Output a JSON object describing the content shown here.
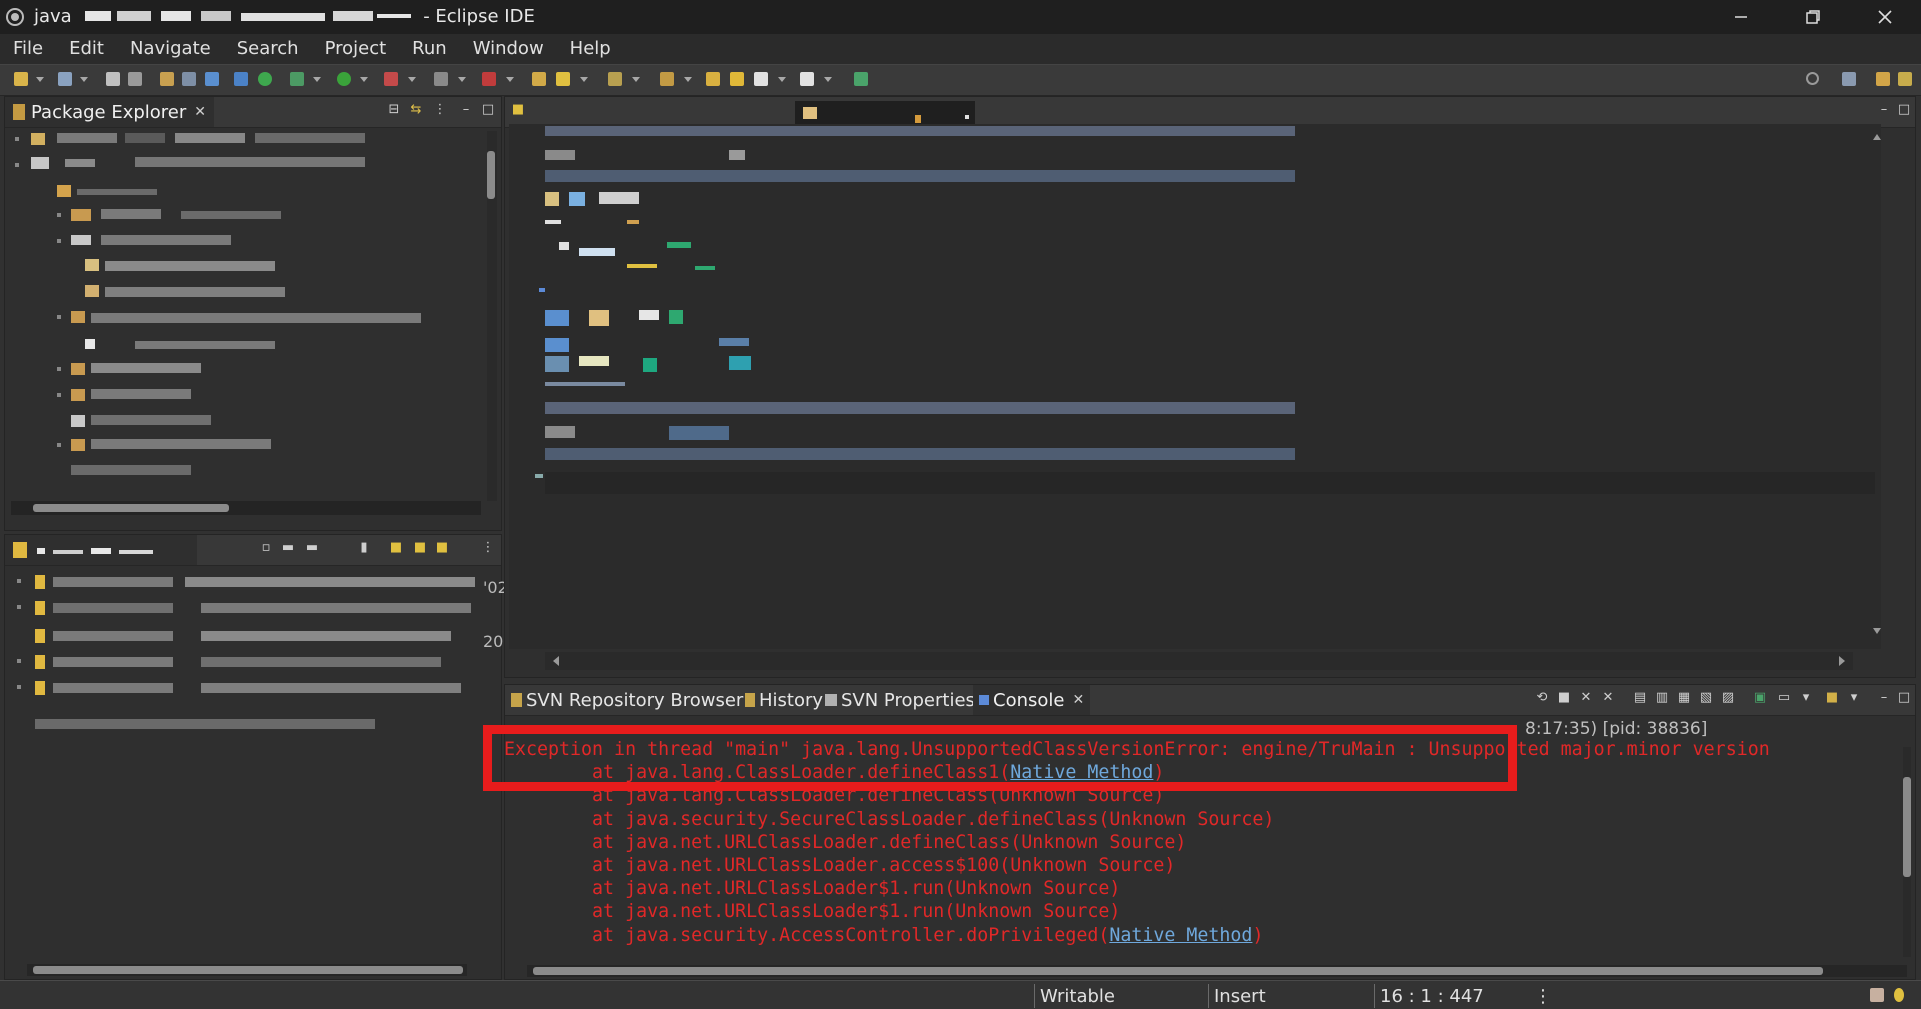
{
  "window": {
    "app_name": "java",
    "title_suffix": "- Eclipse IDE"
  },
  "menu": [
    "File",
    "Edit",
    "Navigate",
    "Search",
    "Project",
    "Run",
    "Window",
    "Help"
  ],
  "package_explorer": {
    "tab_label": "Package Explorer",
    "close_glyph": "✕"
  },
  "bottom_left_panel": {
    "side_fragments": [
      "'02",
      "20"
    ]
  },
  "console_view": {
    "tabs": [
      {
        "label": "SVN Repository Browser",
        "icon": "svn-repository-icon"
      },
      {
        "label": "History",
        "icon": "history-icon"
      },
      {
        "label": "SVN Properties",
        "icon": "svn-properties-icon"
      },
      {
        "label": "Console",
        "icon": "console-icon",
        "active": true
      }
    ],
    "close_glyph": "✕",
    "header_fragment": "8:17:35) [pid: 38836]",
    "lines": [
      {
        "prefix": "Exception in thread \"main\" java.lang.UnsupportedClassVersionError: engine/TruMain : Unsupported major.minor version",
        "link": "",
        "suffix": ""
      },
      {
        "prefix": "\tat java.lang.ClassLoader.defineClass1(",
        "link": "Native Method",
        "suffix": ")"
      },
      {
        "prefix": "\tat java.lang.ClassLoader.defineClass(Unknown Source)",
        "link": "",
        "suffix": ""
      },
      {
        "prefix": "\tat java.security.SecureClassLoader.defineClass(Unknown Source)",
        "link": "",
        "suffix": ""
      },
      {
        "prefix": "\tat java.net.URLClassLoader.defineClass(Unknown Source)",
        "link": "",
        "suffix": ""
      },
      {
        "prefix": "\tat java.net.URLClassLoader.access$100(Unknown Source)",
        "link": "",
        "suffix": ""
      },
      {
        "prefix": "\tat java.net.URLClassLoader$1.run(Unknown Source)",
        "link": "",
        "suffix": ""
      },
      {
        "prefix": "\tat java.net.URLClassLoader$1.run(Unknown Source)",
        "link": "",
        "suffix": ""
      },
      {
        "prefix": "\tat java.security.AccessController.doPrivileged(",
        "link": "Native Method",
        "suffix": ")"
      }
    ],
    "highlight_color": "#e81c1c"
  },
  "statusbar": {
    "mode": "Writable",
    "insert": "Insert",
    "position": "16 : 1 : 447",
    "more_glyph": "⋮"
  },
  "colors": {
    "console_error": "#e12828",
    "link": "#6fa8dc",
    "background": "#2f2f2f",
    "titlebar": "#1f1f1f"
  }
}
